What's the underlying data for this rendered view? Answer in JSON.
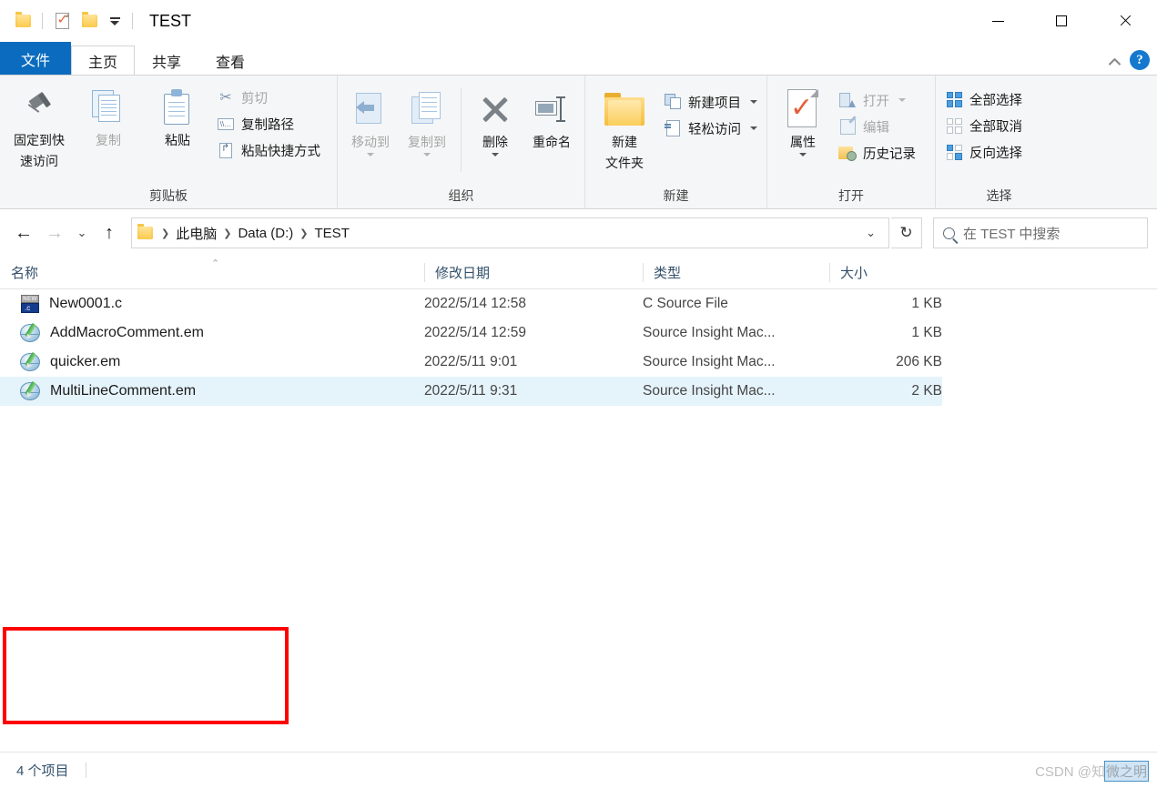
{
  "window": {
    "title": "TEST",
    "quick_access": [
      {
        "name": "folder-icon",
        "label": "文件夹"
      },
      {
        "name": "properties-icon",
        "label": "属性"
      },
      {
        "name": "new-folder-icon",
        "label": "新建文件夹"
      },
      {
        "name": "customize-dropdown",
        "label": "自定义快速访问工具栏"
      }
    ],
    "controls": {
      "minimize": "—",
      "maximize": "▢",
      "close": "✕"
    }
  },
  "tabs": [
    {
      "id": "file",
      "label": "文件"
    },
    {
      "id": "home",
      "label": "主页"
    },
    {
      "id": "share",
      "label": "共享"
    },
    {
      "id": "view",
      "label": "查看"
    }
  ],
  "tab_right": {
    "collapse": "^",
    "help": "?"
  },
  "ribbon": {
    "groups": [
      {
        "label": "剪贴板",
        "big": [
          {
            "label1": "固定到快",
            "label2": "速访问",
            "icon": "pin-icon",
            "disabled": false
          },
          {
            "label1": "复制",
            "label2": "",
            "icon": "copy-icon",
            "disabled": true
          },
          {
            "label1": "粘贴",
            "label2": "",
            "icon": "paste-icon",
            "disabled": false
          }
        ],
        "small": [
          {
            "label": "剪切",
            "icon": "scissors-icon",
            "disabled": true
          },
          {
            "label": "复制路径",
            "icon": "copy-path-icon",
            "disabled": false
          },
          {
            "label": "粘贴快捷方式",
            "icon": "paste-shortcut-icon",
            "disabled": false
          }
        ]
      },
      {
        "label": "组织",
        "big": [
          {
            "label1": "移动到",
            "label2": "",
            "icon": "move-to-icon",
            "dropdown": true,
            "disabled": true
          },
          {
            "label1": "复制到",
            "label2": "",
            "icon": "copy-to-icon",
            "dropdown": true,
            "disabled": true
          },
          {
            "label1": "删除",
            "label2": "",
            "icon": "delete-icon",
            "dropdown": true,
            "disabled": false
          },
          {
            "label1": "重命名",
            "label2": "",
            "icon": "rename-icon",
            "disabled": false
          }
        ],
        "small": []
      },
      {
        "label": "新建",
        "big": [
          {
            "label1": "新建",
            "label2": "文件夹",
            "icon": "new-folder-icon",
            "disabled": false
          }
        ],
        "small": [
          {
            "label": "新建项目",
            "icon": "new-item-icon",
            "dropdown": true,
            "disabled": false
          },
          {
            "label": "轻松访问",
            "icon": "easy-access-icon",
            "dropdown": true,
            "disabled": false
          }
        ]
      },
      {
        "label": "打开",
        "big": [
          {
            "label1": "属性",
            "label2": "",
            "icon": "properties-icon",
            "dropdown": true,
            "disabled": false
          }
        ],
        "small": [
          {
            "label": "打开",
            "icon": "open-icon",
            "dropdown": true,
            "disabled": true
          },
          {
            "label": "编辑",
            "icon": "edit-icon",
            "disabled": true
          },
          {
            "label": "历史记录",
            "icon": "history-icon",
            "disabled": false
          }
        ]
      },
      {
        "label": "选择",
        "big": [],
        "small": [
          {
            "label": "全部选择",
            "icon": "select-all-icon",
            "disabled": false
          },
          {
            "label": "全部取消",
            "icon": "select-none-icon",
            "disabled": false
          },
          {
            "label": "反向选择",
            "icon": "invert-selection-icon",
            "disabled": false
          }
        ]
      }
    ]
  },
  "address": {
    "back": "←",
    "forward": "→",
    "recent": "⌄",
    "up": "↑",
    "breadcrumb": [
      "此电脑",
      "Data (D:)",
      "TEST"
    ],
    "dropdown": "⌄",
    "refresh": "↻"
  },
  "search": {
    "placeholder": "在 TEST 中搜索",
    "value": ""
  },
  "columns": [
    {
      "key": "name",
      "label": "名称"
    },
    {
      "key": "date",
      "label": "修改日期"
    },
    {
      "key": "type",
      "label": "类型"
    },
    {
      "key": "size",
      "label": "大小"
    }
  ],
  "files": [
    {
      "name": "New0001.c",
      "date": "2022/5/14 12:58",
      "type": "C Source File",
      "size": "1 KB",
      "icon": "c-source-file-icon",
      "selected": false
    },
    {
      "name": "AddMacroComment.em",
      "date": "2022/5/14 12:59",
      "type": "Source Insight Mac...",
      "size": "1 KB",
      "icon": "source-insight-macro-icon",
      "selected": false
    },
    {
      "name": "quicker.em",
      "date": "2022/5/11 9:01",
      "type": "Source Insight Mac...",
      "size": "206 KB",
      "icon": "source-insight-macro-icon",
      "selected": false
    },
    {
      "name": "MultiLineComment.em",
      "date": "2022/5/11 9:31",
      "type": "Source Insight Mac...",
      "size": "2 KB",
      "icon": "source-insight-macro-icon",
      "selected": true
    }
  ],
  "annotation": {
    "color": "#FF0000"
  },
  "status": {
    "items_text": "4 个项目"
  },
  "watermark": {
    "prefix": "CSDN @知",
    "highlighted": "微之明"
  }
}
